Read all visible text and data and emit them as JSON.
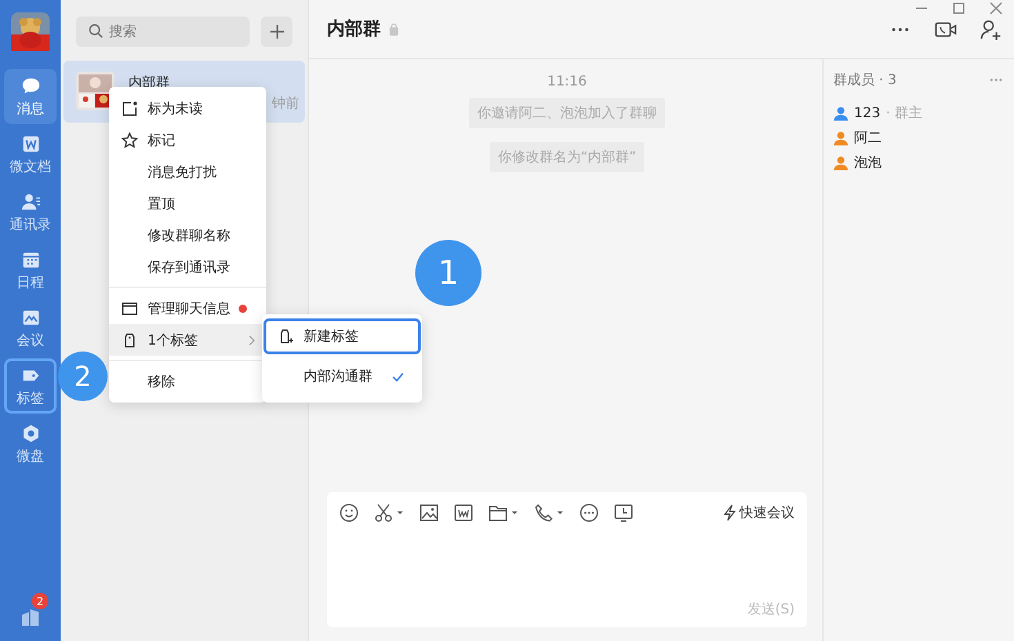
{
  "sidebar": {
    "items": [
      {
        "label": "消息",
        "selected": true,
        "outlined": false
      },
      {
        "label": "微文档",
        "selected": false,
        "outlined": false
      },
      {
        "label": "通讯录",
        "selected": false,
        "outlined": false
      },
      {
        "label": "日程",
        "selected": false,
        "outlined": false
      },
      {
        "label": "会议",
        "selected": false,
        "outlined": false
      },
      {
        "label": "标签",
        "selected": false,
        "outlined": true
      },
      {
        "label": "微盘",
        "selected": false,
        "outlined": false
      }
    ],
    "badge": "2"
  },
  "search": {
    "placeholder": "搜索"
  },
  "conversations": [
    {
      "name": "内部群",
      "time": "钟前",
      "selected": true
    }
  ],
  "context_menu": {
    "items": [
      {
        "kind": "item",
        "label": "标为未读",
        "selected": false,
        "alert": false
      },
      {
        "kind": "item",
        "label": "标记",
        "selected": false,
        "alert": false
      },
      {
        "kind": "item",
        "label": "消息免打扰",
        "selected": false,
        "alert": false
      },
      {
        "kind": "item",
        "label": "置顶",
        "selected": false,
        "alert": false
      },
      {
        "kind": "item",
        "label": "修改群聊名称",
        "selected": false,
        "alert": false
      },
      {
        "kind": "item",
        "label": "保存到通讯录",
        "selected": false,
        "alert": false
      },
      {
        "kind": "divider"
      },
      {
        "kind": "item",
        "label": "管理聊天信息",
        "selected": false,
        "alert": true
      },
      {
        "kind": "submenu",
        "label": "1个标签",
        "selected": true,
        "alert": false
      },
      {
        "kind": "divider"
      },
      {
        "kind": "item",
        "label": "移除",
        "selected": false,
        "alert": false
      }
    ]
  },
  "submenu": {
    "items": [
      {
        "kind": "new",
        "label": "新建标签",
        "selected": true,
        "checked": false
      },
      {
        "kind": "tag",
        "label": "内部沟通群",
        "selected": false,
        "checked": true
      }
    ]
  },
  "chat": {
    "title": "内部群",
    "time": "11:16",
    "notices": [
      "你邀请阿二、泡泡加入了群聊",
      "你修改群名为“内部群”"
    ]
  },
  "members": {
    "heading": "群成员 · 3",
    "items": [
      {
        "name": "123",
        "role": "· 群主",
        "color": "#3b8ef0"
      },
      {
        "name": "阿二",
        "color": "#f08a24"
      },
      {
        "name": "泡泡",
        "color": "#f08a24"
      }
    ]
  },
  "composer": {
    "quick_meeting": "快速会议",
    "send": "发送(S)",
    "send_disabled": true
  },
  "annotations": [
    {
      "label": "1"
    },
    {
      "label": "2"
    }
  ]
}
